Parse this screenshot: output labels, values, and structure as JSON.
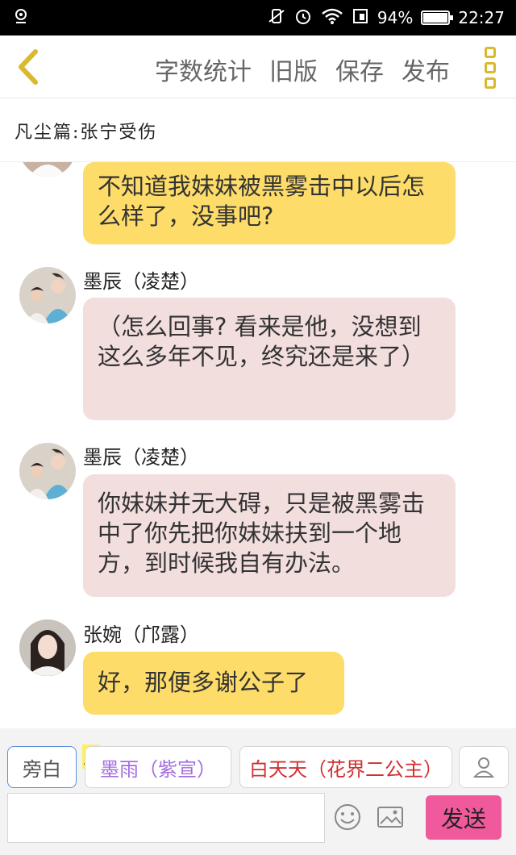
{
  "status": {
    "battery": "94%",
    "battery_level": 0.94,
    "time": "22:27"
  },
  "toolbar": {
    "word_count": "字数统计",
    "old_version": "旧版",
    "save": "保存",
    "publish": "发布"
  },
  "chapter_title": "凡尘篇:张宁受伤",
  "messages": [
    {
      "text": "不知道我妹妹被黑雾击中以后怎么样了，没事吧?"
    },
    {
      "speaker": "墨辰（凌楚）",
      "text": "（怎么回事? 看来是他，没想到这么多年不见，终究还是来了）"
    },
    {
      "speaker": "墨辰（凌楚）",
      "text": "你妹妹并无大碍，只是被黑雾击中了你先把你妹妹扶到一个地方，到时候我自有办法。"
    },
    {
      "speaker": "张婉（邝露）",
      "text": "好，那便多谢公子了"
    }
  ],
  "roles": {
    "narration": "旁白",
    "main_badge": "主",
    "role1": "墨雨（紫宣）",
    "role2": "白天天（花界二公主）"
  },
  "composer": {
    "input_value": "",
    "send": "发送"
  },
  "colors": {
    "accent": "#fddc6a",
    "pink_bubble": "#f3dede",
    "send": "#f05a9c",
    "role1": "#a26ee0",
    "role2": "#d23030"
  },
  "icons": [
    "back-arrow-icon",
    "more-menu-icon",
    "person-icon",
    "emoji-icon",
    "image-icon",
    "wifi-icon",
    "alarm-icon",
    "battery-icon"
  ]
}
